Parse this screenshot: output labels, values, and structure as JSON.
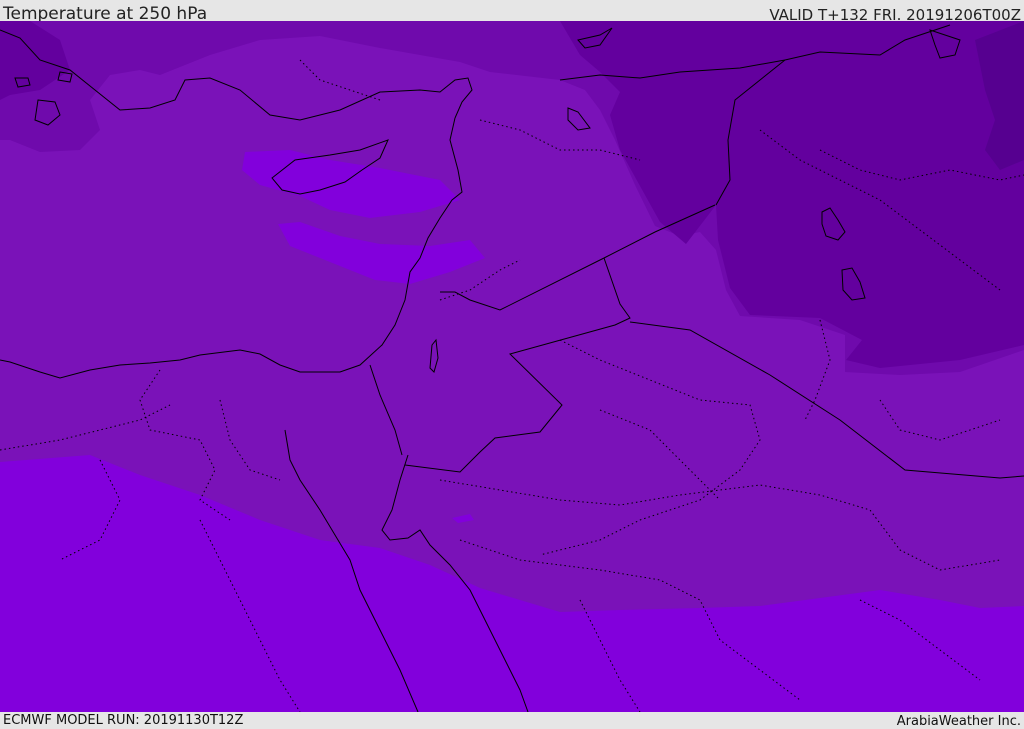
{
  "header": {
    "title": "Temperature at 250 hPa",
    "valid": "VALID T+132 FRI. 20191206T00Z"
  },
  "footer": {
    "model_run": "ECMWF MODEL RUN: 20191130T12Z",
    "provider": "ArabiaWeather Inc."
  },
  "map": {
    "colors": {
      "coldest": "#560090",
      "colder": "#63009e",
      "cold": "#6f0aac",
      "mid": "#7a12b8",
      "warm": "#8200dc",
      "border": "#000000"
    }
  }
}
